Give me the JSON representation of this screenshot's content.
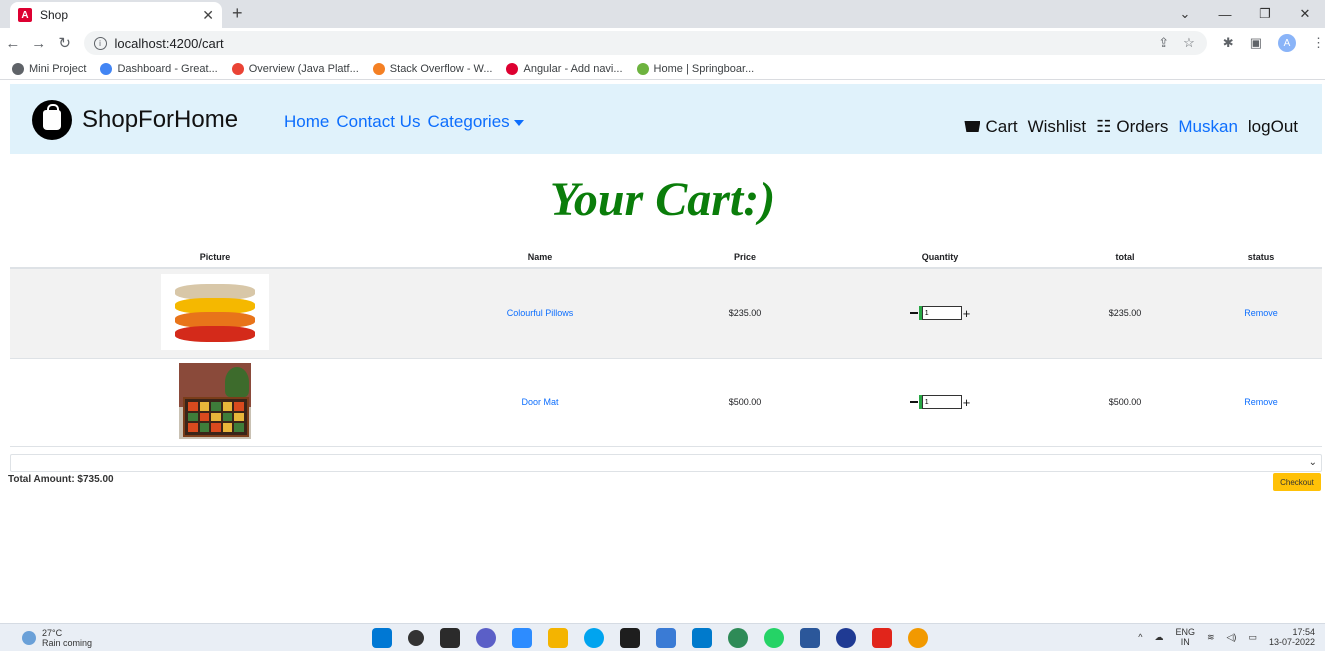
{
  "browser": {
    "tab_title": "Shop",
    "tab_favicon": "A",
    "url": "localhost:4200/cart",
    "profile_initial": "A",
    "bookmarks": [
      {
        "label": "Mini Project",
        "color": "#5f6368"
      },
      {
        "label": "Dashboard - Great...",
        "color": "#4285f4"
      },
      {
        "label": "Overview (Java Platf...",
        "color": "#ea4335"
      },
      {
        "label": "Stack Overflow - W...",
        "color": "#f48024"
      },
      {
        "label": "Angular - Add navi...",
        "color": "#dd0031"
      },
      {
        "label": "Home | Springboar...",
        "color": "#6db33f"
      }
    ]
  },
  "navbar": {
    "brand": "ShopForHome",
    "links": [
      "Home",
      "Contact Us",
      "Categories"
    ],
    "cart": "Cart",
    "wishlist": "Wishlist",
    "orders": "Orders",
    "user": "Muskan",
    "logout": "logOut"
  },
  "page": {
    "title": "Your Cart:)"
  },
  "cart_table": {
    "headers": [
      "Picture",
      "Name",
      "Price",
      "Quantity",
      "total",
      "status"
    ],
    "rows": [
      {
        "name": "Colourful Pillows",
        "price": "$235.00",
        "quantity": "1",
        "total": "$235.00",
        "status": "Remove"
      },
      {
        "name": "Door Mat",
        "price": "$500.00",
        "quantity": "1",
        "total": "$500.00",
        "status": "Remove"
      }
    ]
  },
  "summary": {
    "total_label": "Total Amount: $735.00",
    "checkout": "Checkout"
  },
  "taskbar": {
    "temperature": "27°C",
    "weather": "Rain coming",
    "lang_top": "ENG",
    "lang_bottom": "IN",
    "time": "17:54",
    "date": "13-07-2022",
    "app_colors": [
      "#0078d4",
      "#333333",
      "#2b2b2b",
      "#5b5fc7",
      "#2d8cff",
      "#f4b400",
      "#00a4ef",
      "#1e1e1e",
      "#3a7bd5",
      "#007acc",
      "#2e8b57",
      "#25d366",
      "#2b579a",
      "#1f3a93",
      "#e1251b",
      "#f29900"
    ]
  },
  "colors": {
    "accent": "#0d6efd",
    "title_green": "#0a7d0a",
    "navbar_bg": "#e0f2fb",
    "checkout_bg": "#ffc107"
  }
}
